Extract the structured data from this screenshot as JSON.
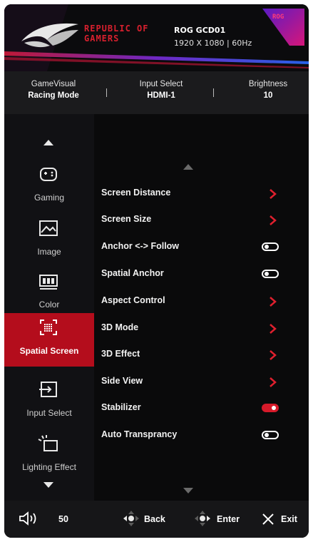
{
  "header": {
    "brand_line1": "REPUBLIC OF",
    "brand_line2": "GAMERS",
    "badge": "ROG",
    "model": "ROG GCD01",
    "resolution": "1920 X 1080 | 60Hz"
  },
  "status": {
    "gamevisual_label": "GameVisual",
    "gamevisual_value": "Racing Mode",
    "input_label": "Input Select",
    "input_value": "HDMI-1",
    "brightness_label": "Brightness",
    "brightness_value": "10"
  },
  "sidebar": {
    "items": [
      {
        "label": "Gaming",
        "icon": "gamepad-icon"
      },
      {
        "label": "Image",
        "icon": "image-icon"
      },
      {
        "label": "Color",
        "icon": "color-icon"
      },
      {
        "label": "Spatial Screen",
        "icon": "spatial-screen-icon",
        "active": true
      },
      {
        "label": "Input Select",
        "icon": "input-select-icon"
      },
      {
        "label": "Lighting Effect",
        "icon": "lighting-icon"
      }
    ]
  },
  "menu": {
    "items": [
      {
        "label": "Screen Distance",
        "control": "submenu"
      },
      {
        "label": "Screen Size",
        "control": "submenu"
      },
      {
        "label": "Anchor <-> Follow",
        "control": "toggle",
        "state": "off"
      },
      {
        "label": "Spatial Anchor",
        "control": "toggle",
        "state": "off"
      },
      {
        "label": "Aspect Control",
        "control": "submenu"
      },
      {
        "label": "3D Mode",
        "control": "submenu"
      },
      {
        "label": "3D Effect",
        "control": "submenu"
      },
      {
        "label": "Side View",
        "control": "submenu"
      },
      {
        "label": "Stabilizer",
        "control": "toggle",
        "state": "on"
      },
      {
        "label": "Auto Transprancy",
        "control": "toggle",
        "state": "off"
      }
    ]
  },
  "footer": {
    "volume": "50",
    "back": "Back",
    "enter": "Enter",
    "exit": "Exit"
  },
  "colors": {
    "accent_red": "#b40d1c",
    "chevron_red": "#e0202e",
    "toggle_on": "#d61a2a"
  }
}
